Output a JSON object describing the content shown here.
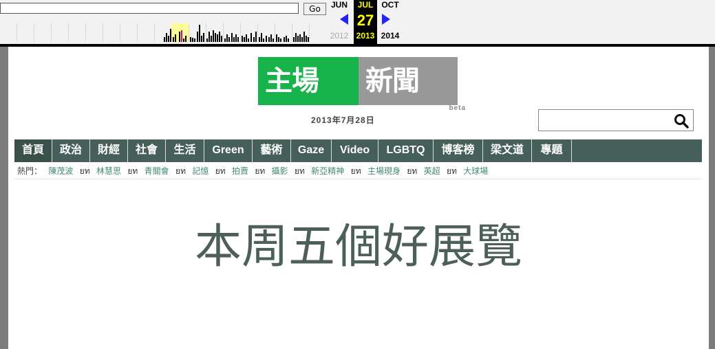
{
  "wayback": {
    "go_label": "Go",
    "prev_month": "JUN",
    "cur_month": "JUL",
    "next_month": "OCT",
    "cur_day": "27",
    "prev_year": "2012",
    "cur_year": "2013",
    "next_year": "2014",
    "colors": {
      "current_bg": "#000000",
      "current_text": "#ffff00",
      "arrow": "#2222ff",
      "spark_highlight": "#ffff99"
    }
  },
  "logo": {
    "text_green": "主場",
    "text_gray": "新聞",
    "beta": "beta"
  },
  "date": "2013年7月28日",
  "nav": {
    "items": [
      "首頁",
      "政治",
      "財經",
      "社會",
      "生活",
      "Green",
      "藝術",
      "Gaze",
      "Video",
      "LGBTQ",
      "博客榜",
      "梁文道",
      "專題"
    ],
    "bg_color": "#465f5a"
  },
  "hot": {
    "label": "熱門：",
    "separator": "ยท",
    "links": [
      "陳茂波",
      "林慧思",
      "青關會",
      "記憶",
      "拍賣",
      "攝影",
      "新亞精神",
      "主場現身",
      "英超",
      "大球場"
    ]
  },
  "headline": "本周五個好展覽"
}
